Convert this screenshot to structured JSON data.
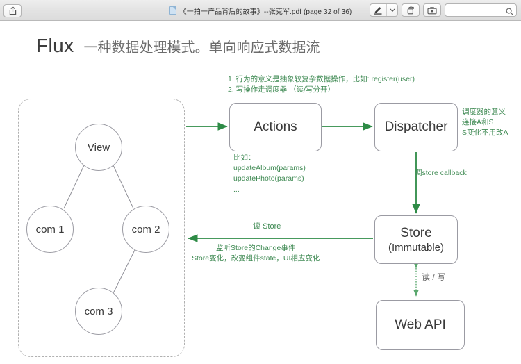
{
  "window": {
    "title": "《一拍一产品背后的故事》--张克军.pdf (page 32 of 36)",
    "doc_icon": "pdf-document-icon"
  },
  "toolbar": {
    "share_icon": "share-icon",
    "markup_icon": "markup-pen-icon",
    "markup_dropdown_icon": "chevron-down-icon",
    "rotate_icon": "rotate-icon",
    "toolkit_icon": "toolbox-icon",
    "search_icon": "search-icon",
    "search_value": "",
    "search_placeholder": ""
  },
  "slide": {
    "title_main": "Flux",
    "title_sub": "一种数据处理模式。单向响应式数据流",
    "boxes": {
      "actions": "Actions",
      "dispatcher": "Dispatcher",
      "store_line1": "Store",
      "store_line2": "(Immutable)",
      "webapi": "Web API"
    },
    "circles": {
      "view": "View",
      "com1": "com 1",
      "com2": "com 2",
      "com3": "com 3"
    },
    "notes": {
      "actions_rules": "1. 行为的意义是抽象较复杂数据操作，比如: register(user)\n2. 写操作走调度器 （读/写分开）",
      "actions_example": "比如：\nupdateAlbum(params)\nupdatePhoto(params)\n...",
      "dispatcher_meaning": "调度器的意义\n连接A和S\nS变化不用改A",
      "store_callback": "调store callback",
      "read_store": "读 Store",
      "listen_change": "监听Store的Change事件\nStore变化，改变组件state，UI相应变化",
      "read_write": "读 / 写"
    },
    "colors": {
      "arrow_green": "#2e8b46",
      "note_green": "#3f8a53",
      "box_border": "#9b9ba3",
      "text_dark": "#3a3a3a",
      "text_gray": "#6c6c6c"
    }
  }
}
